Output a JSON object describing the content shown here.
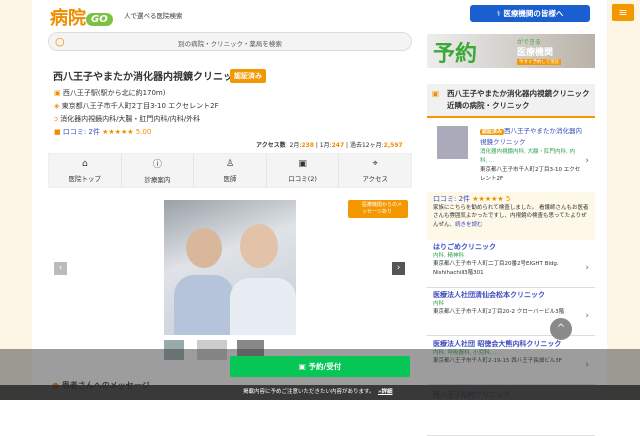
{
  "header": {
    "logo": "病院",
    "logo_badge": "GO",
    "tagline": "人で選べる医院検索",
    "pro_button": "医療機関の皆様へ",
    "menu_icon": "hamburger-icon"
  },
  "search": {
    "placeholder": "別の病院・クリニック・薬局を検索"
  },
  "clinic": {
    "name": "西八王子やまたか消化器内視鏡クリニック",
    "badge": "認証済み",
    "station": "西八王子駅(駅から北に約170m)",
    "address": "東京都八王子市千人町2丁目3-10 エクセレント2F",
    "departments": "消化器内視鏡内科/大腸・肛門内科/内科/外科",
    "reviews_label": "口コミ: 2件",
    "stars": "★★★★★",
    "rating": "5.00"
  },
  "access": {
    "label": "アクセス数",
    "m2_label": "2月:",
    "m2": "238",
    "m1_label": "1月:",
    "m1": "247",
    "y_label": "過去12ヶ月:",
    "y": "2,597"
  },
  "tabs": [
    {
      "label": "医院トップ",
      "icon": "home-icon",
      "g": "⌂"
    },
    {
      "label": "診療案内",
      "icon": "info-icon",
      "g": "ⓘ"
    },
    {
      "label": "医師",
      "icon": "doctor-icon",
      "g": "♙"
    },
    {
      "label": "口コミ(2)",
      "icon": "review-icon",
      "g": "▣"
    },
    {
      "label": "アクセス",
      "icon": "map-icon",
      "g": "⌖"
    }
  ],
  "message_badge": "医療機関からのメッセージあり",
  "section": {
    "patients_message": "患者さんへのメッセージ"
  },
  "reserve_button": "予約/受付",
  "notice": {
    "text": "掲載内容に予めご注意いただきたい内容があります。",
    "link": "»詳細"
  },
  "ad": {
    "big": "予約",
    "small": "ができる",
    "sub": "医療機関",
    "cta": "今すぐ予約して受診"
  },
  "sidebar": {
    "title": "西八王子やまたか消化器内視鏡クリニック 近隣の病院・クリニック",
    "featured": {
      "badge": "認証済み",
      "name": "西八王子やまたか消化器内視鏡クリニック",
      "dept": "消化器内視鏡内科, 大腸・肛門内科, 内科, ...",
      "address": "東京都八王子市千人町2丁目3-10 エクセレント2F"
    },
    "review": {
      "label": "口コミ: 2件",
      "stars": "★★★★★",
      "score": "5",
      "text": "家族にこちらを勧められて検査しました。 看護師さんもお医者さんも雰囲気よかったですし、内視鏡の検査も思ってたよりぜんぜん、",
      "more": "続きを読む"
    },
    "items": [
      {
        "name": "はりごめクリニック",
        "dept": "内科, 精神科",
        "address": "東京都八王子市千人町二丁目20番2号EIGHT Bldg. NishihachiⅡ3階301"
      },
      {
        "name": "医療法人社団清仙会松本クリニック",
        "dept": "内科",
        "address": "東京都八王子市千人町2丁目20-2 クローバービル3階"
      },
      {
        "name": "医療法人社団 昭徳会大熊内科クリニック",
        "dept": "内科, 呼吸器科, 小児科, ...",
        "address": "東京都八王子市千人町2-19-15 西八王子長畑ビル3F"
      },
      {
        "name": "西八王子松村クリニック"
      }
    ]
  }
}
